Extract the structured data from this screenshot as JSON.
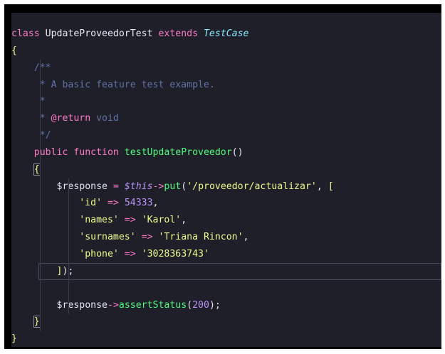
{
  "editor": {
    "lines": [
      {
        "tokens": [
          {
            "text": "class ",
            "kind": "kw"
          },
          {
            "text": "UpdateProveedorTest",
            "kind": "cls"
          },
          {
            "text": " extends ",
            "kind": "kw"
          },
          {
            "text": "TestCase",
            "kind": "type"
          }
        ]
      },
      {
        "tokens": [
          {
            "text": "{",
            "kind": "brace"
          }
        ]
      },
      {
        "tokens": [
          {
            "text": "    /**",
            "kind": "comment"
          }
        ]
      },
      {
        "tokens": [
          {
            "text": "     * A basic feature test example.",
            "kind": "comment"
          }
        ]
      },
      {
        "tokens": [
          {
            "text": "     *",
            "kind": "comment"
          }
        ]
      },
      {
        "tokens": [
          {
            "text": "     * ",
            "kind": "comment"
          },
          {
            "text": "@return",
            "kind": "doc-tag"
          },
          {
            "text": " void",
            "kind": "comment"
          }
        ]
      },
      {
        "tokens": [
          {
            "text": "     */",
            "kind": "comment"
          }
        ]
      },
      {
        "tokens": [
          {
            "text": "    public function ",
            "kind": "kw"
          },
          {
            "text": "testUpdateProveedor",
            "kind": "fn"
          },
          {
            "text": "()",
            "kind": "paren"
          }
        ]
      },
      {
        "tokens": [
          {
            "text": "    ",
            "kind": "punct"
          },
          {
            "text": "{",
            "kind": "brace-box"
          }
        ]
      },
      {
        "tokens": [
          {
            "text": "        $response ",
            "kind": "var"
          },
          {
            "text": "= ",
            "kind": "op"
          },
          {
            "text": "$this",
            "kind": "this"
          },
          {
            "text": "->",
            "kind": "op"
          },
          {
            "text": "put",
            "kind": "fn"
          },
          {
            "text": "(",
            "kind": "paren"
          },
          {
            "text": "'/proveedor/actualizar'",
            "kind": "str"
          },
          {
            "text": ", ",
            "kind": "punct"
          },
          {
            "text": "[",
            "kind": "brace"
          }
        ]
      },
      {
        "tokens": [
          {
            "text": "            ",
            "kind": "punct"
          },
          {
            "text": "'id'",
            "kind": "str"
          },
          {
            "text": " => ",
            "kind": "op"
          },
          {
            "text": "54333",
            "kind": "num"
          },
          {
            "text": ",",
            "kind": "punct"
          }
        ]
      },
      {
        "tokens": [
          {
            "text": "            ",
            "kind": "punct"
          },
          {
            "text": "'names'",
            "kind": "str"
          },
          {
            "text": " => ",
            "kind": "op"
          },
          {
            "text": "'Karol'",
            "kind": "str"
          },
          {
            "text": ",",
            "kind": "punct"
          }
        ]
      },
      {
        "tokens": [
          {
            "text": "            ",
            "kind": "punct"
          },
          {
            "text": "'surnames'",
            "kind": "str"
          },
          {
            "text": " => ",
            "kind": "op"
          },
          {
            "text": "'Triana Rincon'",
            "kind": "str"
          },
          {
            "text": ",",
            "kind": "punct"
          }
        ]
      },
      {
        "tokens": [
          {
            "text": "            ",
            "kind": "punct"
          },
          {
            "text": "'phone'",
            "kind": "str"
          },
          {
            "text": " => ",
            "kind": "op"
          },
          {
            "text": "'3028363743'",
            "kind": "str"
          }
        ]
      },
      {
        "current": true,
        "tokens": [
          {
            "text": "        ",
            "kind": "punct"
          },
          {
            "text": "]",
            "kind": "brace"
          },
          {
            "text": ");",
            "kind": "punct"
          }
        ]
      },
      {
        "tokens": []
      },
      {
        "tokens": [
          {
            "text": "        $response",
            "kind": "var"
          },
          {
            "text": "->",
            "kind": "op"
          },
          {
            "text": "assertStatus",
            "kind": "fn"
          },
          {
            "text": "(",
            "kind": "paren"
          },
          {
            "text": "200",
            "kind": "num"
          },
          {
            "text": ");",
            "kind": "punct"
          }
        ]
      },
      {
        "tokens": [
          {
            "text": "    ",
            "kind": "punct"
          },
          {
            "text": "}",
            "kind": "brace-box"
          }
        ]
      },
      {
        "tokens": [
          {
            "text": "}",
            "kind": "brace"
          }
        ]
      }
    ]
  }
}
